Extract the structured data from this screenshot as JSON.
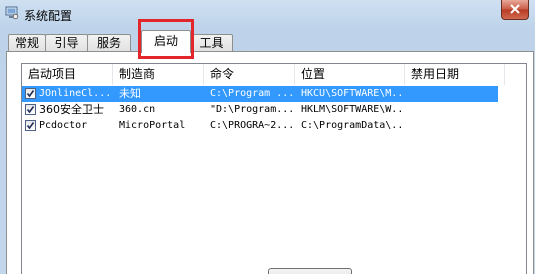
{
  "window": {
    "title": "系统配置"
  },
  "tabs": [
    {
      "label": "常规",
      "active": false
    },
    {
      "label": "引导",
      "active": false
    },
    {
      "label": "服务",
      "active": false
    },
    {
      "label": "启动",
      "active": true
    },
    {
      "label": "工具",
      "active": false
    }
  ],
  "startup_list": {
    "columns": [
      "启动项目",
      "制造商",
      "命令",
      "位置",
      "禁用日期"
    ],
    "rows": [
      {
        "checked": true,
        "item": "JOnlineCl...",
        "manufacturer": "未知",
        "command": "C:\\Program ...",
        "location": "HKCU\\SOFTWARE\\M...",
        "disabled_date": "",
        "selected": true
      },
      {
        "checked": true,
        "item": "360安全卫士",
        "manufacturer": "360.cn",
        "command": "\"D:\\Program...",
        "location": "HKLM\\SOFTWARE\\W...",
        "disabled_date": "",
        "selected": false
      },
      {
        "checked": true,
        "item": "Pcdoctor",
        "manufacturer": "MicroPortal",
        "command": "C:\\PROGRA~2...",
        "location": "C:\\ProgramData\\...",
        "disabled_date": "",
        "selected": false
      }
    ]
  },
  "colors": {
    "selection": "#3399ff",
    "highlight_box": "#e2262b",
    "close_button": "#c75a44"
  }
}
